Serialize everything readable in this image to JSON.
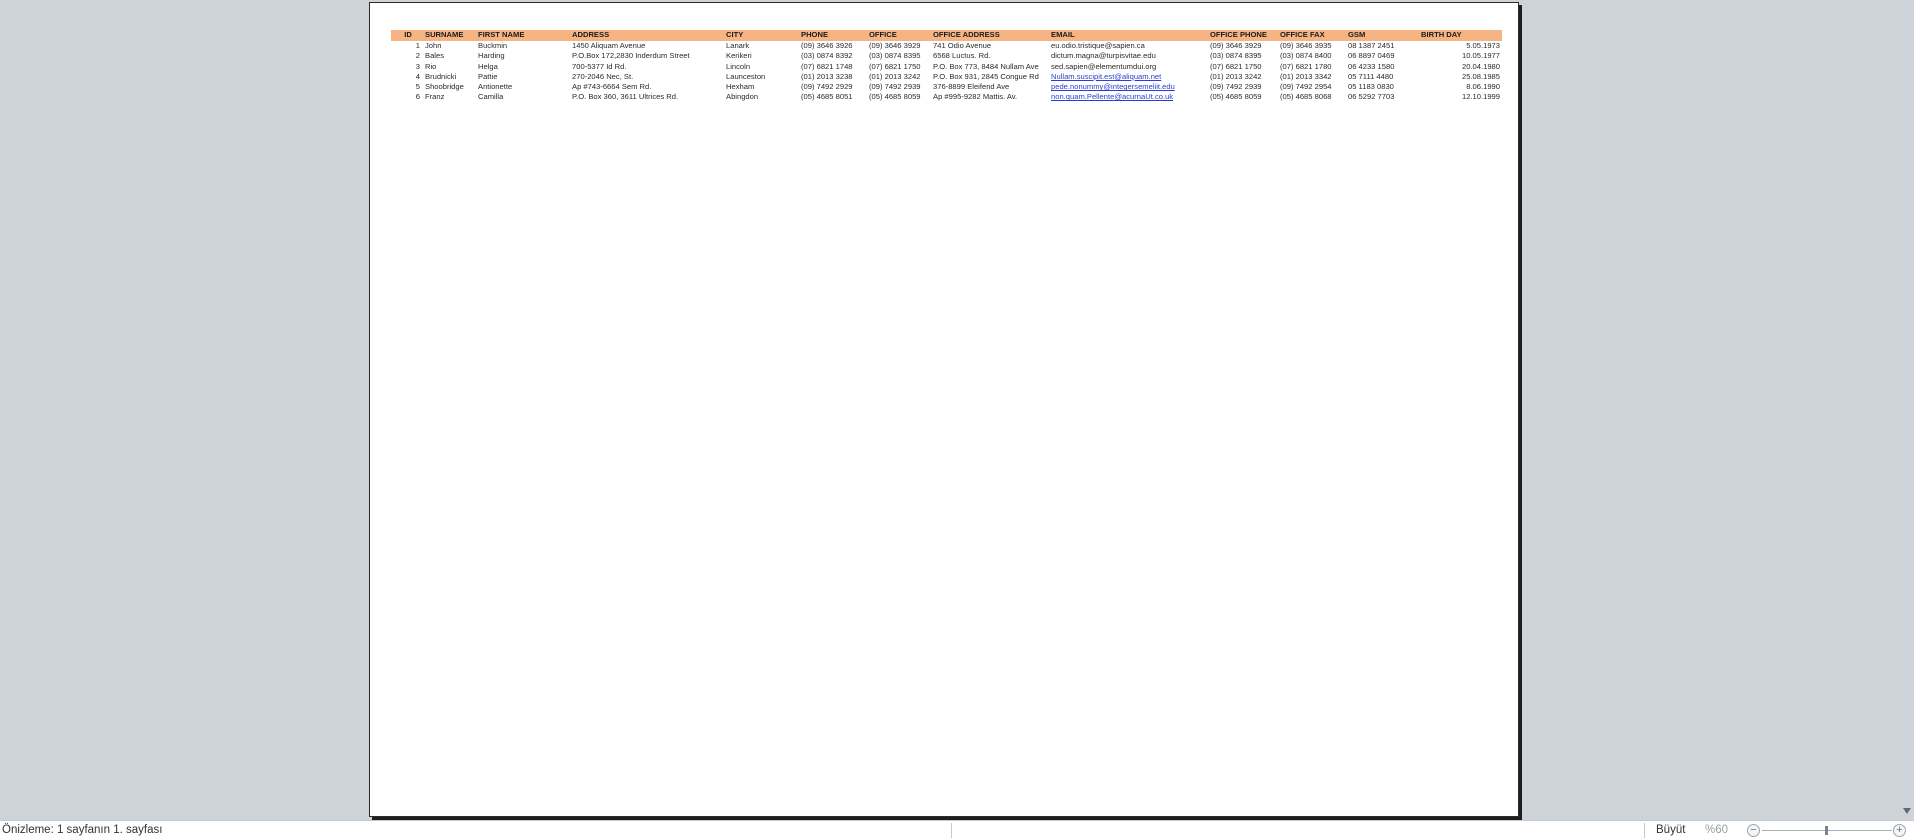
{
  "table": {
    "headers": [
      "ID",
      "SURNAME",
      "FIRST NAME",
      "ADDRESS",
      "CITY",
      "PHONE",
      "OFFICE",
      "OFFICE ADDRESS",
      "EMAIL",
      "OFFICE PHONE",
      "OFFICE FAX",
      "GSM",
      "BIRTH DAY"
    ],
    "rows": [
      [
        "1",
        "John",
        "Buckmin",
        "1450 Aliquam Avenue",
        "Lanark",
        "(09) 3646 3926",
        "(09) 3646 3929",
        "741 Odio Avenue",
        "eu.odio.tristique@sapien.ca",
        "(09) 3646 3929",
        "(09) 3646 3935",
        "08 1387 2451",
        "5.05.1973"
      ],
      [
        "2",
        "Bales",
        "Harding",
        "P.O.Box 172,2830 Inderdum Street",
        "Kerikeri",
        "(03) 0874 8392",
        "(03) 0874 8395",
        "6568 Luctus. Rd.",
        "dictum.magna@turpisvitae.edu",
        "(03) 0874 8395",
        "(03) 0874 8400",
        "06 8897 0469",
        "10.05.1977"
      ],
      [
        "3",
        "Rio",
        "Helga",
        "700-5377 Id Rd.",
        "Lincoln",
        "(07) 6821 1748",
        "(07) 6821 1750",
        "P.O. Box 773, 8484 Nullam Ave",
        "sed.sapien@elementumdui.org",
        "(07) 6821 1750",
        "(07) 6821 1780",
        "06 4233 1580",
        "20.04.1980"
      ],
      [
        "4",
        "Brudnicki",
        "Pattie",
        "270-2046 Nec, St.",
        "Launceston",
        "(01) 2013 3238",
        "(01) 2013 3242",
        "P.O. Box 931, 2845 Congue Rd",
        "Nullam.suscipit.est@aliquam.net",
        "(01) 2013 3242",
        "(01) 2013 3342",
        "05 7111 4480",
        "25.08.1985"
      ],
      [
        "5",
        "Shoobridge",
        "Antionette",
        "Ap #743-6664 Sem Rd.",
        "Hexham",
        "(09) 7492 2929",
        "(09) 7492 2939",
        "376-8899 Eleifend Ave",
        "pede.nonummy@integersemeliit.edu",
        "(09) 7492 2939",
        "(09) 7492 2954",
        "05 1183 0830",
        "8.06.1990"
      ],
      [
        "6",
        "Franz",
        "Camilla",
        "P.O. Box 360, 3611 Ultrices Rd.",
        "Abingdon",
        "(05) 4685 8051",
        "(05) 4685 8059",
        "Ap #995-9282 Mattis. Av.",
        "non.quam.Pellente@acurnaUt.co.uk",
        "(05) 4685 8059",
        "(05) 4685 8068",
        "06 5292 7703",
        "12.10.1999"
      ]
    ],
    "linked_email_rows": [
      3,
      4,
      5
    ]
  },
  "statusbar": {
    "page_info": "Önizleme:  1 sayfanın  1. sayfası",
    "zoom_label": "Büyüt",
    "zoom_level": "%60",
    "zoom_out": "−",
    "zoom_in": "+"
  },
  "colors": {
    "header_fill": "#f7b483",
    "background": "#ced3d9",
    "link": "#2a3fd1"
  }
}
